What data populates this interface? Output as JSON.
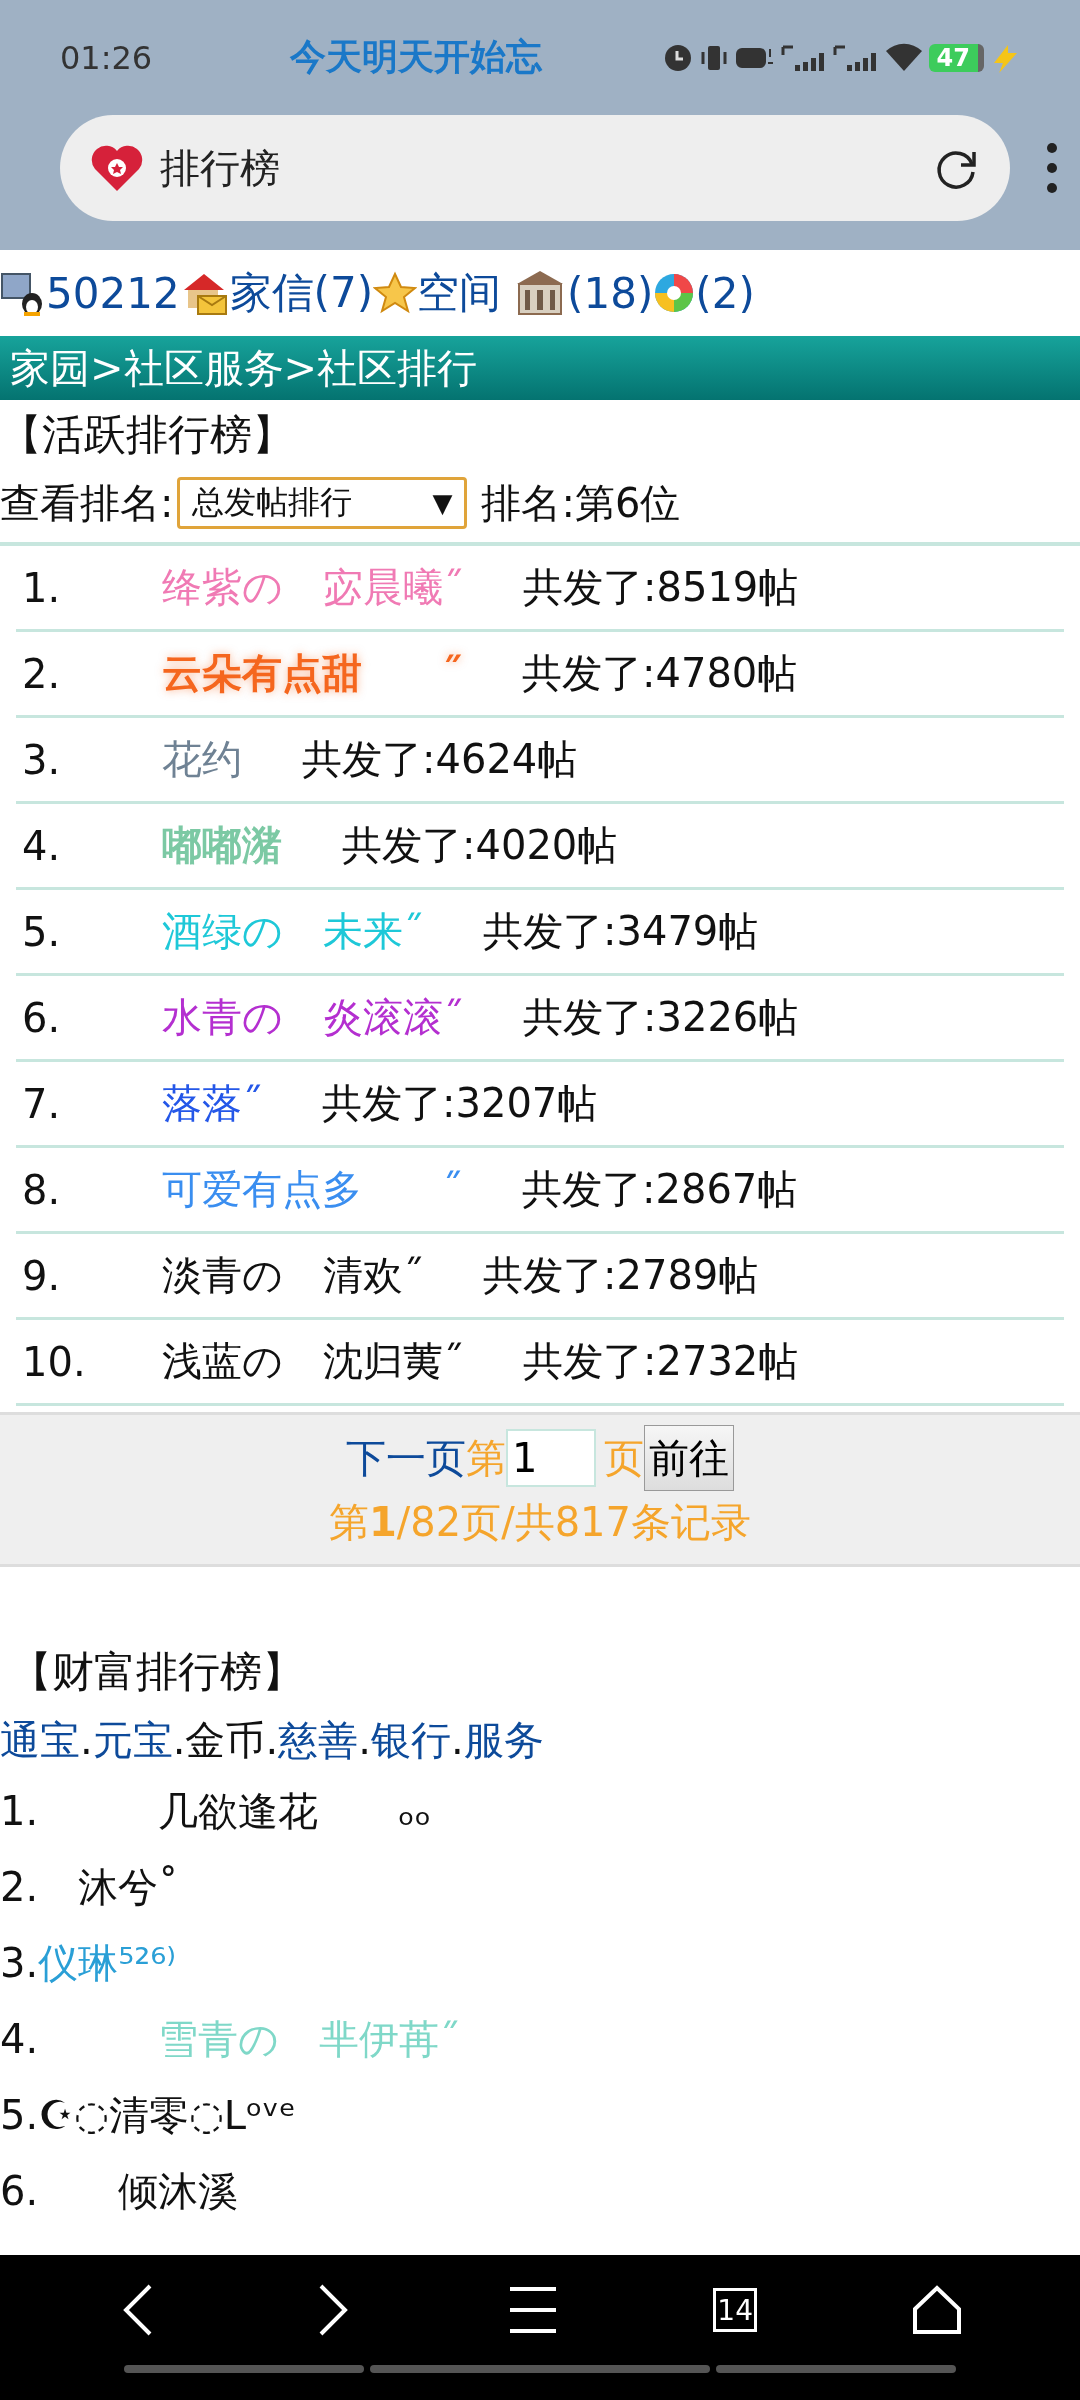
{
  "status_bar": {
    "time": "01:26",
    "ticker": "今天明天开始忘",
    "battery": "47"
  },
  "address_bar": {
    "title": "排行榜"
  },
  "toolbar": [
    {
      "kind": "user",
      "label": "50212"
    },
    {
      "kind": "mail",
      "label": "家信(7)"
    },
    {
      "kind": "star",
      "label": "空间"
    },
    {
      "kind": "building",
      "label": "(18)"
    },
    {
      "kind": "aperture",
      "label": "(2)"
    }
  ],
  "breadcrumb": "家园>社区服务>社区排行",
  "active_ranking": {
    "heading": "【活跃排行榜】",
    "filter_label": "查看排名:",
    "filter_value": "总发帖排行",
    "filter_arrow": "▼",
    "my_rank": "排名:第6位",
    "rows": [
      {
        "rank": "1.",
        "name": "绛紫の　宓晨曦˝",
        "color": "#f07ab4",
        "bold": false,
        "posts": "共发了:8519帖"
      },
      {
        "rank": "2.",
        "name": "云朵有点甜　　˝",
        "color": "#f5661e",
        "bold": true,
        "posts": "共发了:4780帖"
      },
      {
        "rank": "3.",
        "name": "花约",
        "color": "#6f8294",
        "bold": false,
        "posts": "共发了:4624帖"
      },
      {
        "rank": "4.",
        "name": "嘟嘟潴",
        "color": "#7cc9a4",
        "bold": true,
        "posts": "共发了:4020帖"
      },
      {
        "rank": "5.",
        "name": "酒绿の　未来˝",
        "color": "#1ec8d8",
        "bold": false,
        "posts": "共发了:3479帖"
      },
      {
        "rank": "6.",
        "name": "水青の　炎滚滚˝",
        "color": "#b42fd0",
        "bold": false,
        "posts": "共发了:3226帖"
      },
      {
        "rank": "7.",
        "name": "落落˝",
        "color": "#2457e8",
        "bold": false,
        "posts": "共发了:3207帖"
      },
      {
        "rank": "8.",
        "name": "可爱有点多　　˝",
        "color": "#3a8ef0",
        "bold": false,
        "posts": "共发了:2867帖"
      },
      {
        "rank": "9.",
        "name": "淡青の　清欢˝",
        "color": "#111111",
        "bold": false,
        "posts": "共发了:2789帖"
      },
      {
        "rank": "10.",
        "name": "浅蓝の　沈归荑˝",
        "color": "#111111",
        "bold": false,
        "posts": "共发了:2732帖"
      }
    ],
    "pager": {
      "next": "下一页",
      "before_input": "第",
      "page_input": "1",
      "after_input": "页",
      "go_button": "前往",
      "summary": "第**1**/82页/共817条记录"
    }
  },
  "wealth_ranking": {
    "heading": "【财富排行榜】",
    "tabs": [
      {
        "label": "通宝",
        "selected": false
      },
      {
        "sep": ".",
        "label": "元宝",
        "selected": false
      },
      {
        "sep": ".",
        "label": "金币",
        "selected": true
      },
      {
        "sep": ".",
        "label": "慈善",
        "selected": false
      },
      {
        "sep": ".",
        "label": "银行",
        "selected": false
      },
      {
        "sep": ".",
        "label": "服务",
        "selected": false
      }
    ],
    "rows": [
      {
        "rank": "1.",
        "name": "　　　几欲逢花　　ₒₒ",
        "color": "#111111"
      },
      {
        "rank": "2.",
        "name": "　沐兮˚",
        "color": "#111111"
      },
      {
        "rank": "3.",
        "name": "仪琳⁵²⁶⁾",
        "color": "#2a9fd6"
      },
      {
        "rank": "4.",
        "name": "　　　雪青の　芈伊苒˝",
        "color": "#7fd8c8"
      },
      {
        "rank": "5.",
        "name": "☪◌清零◌ᒪᵒᵛᵉ",
        "color": "#111111"
      },
      {
        "rank": "6.",
        "name": "　　倾沐溪",
        "color": "#111111"
      }
    ]
  },
  "nav_bar": {
    "tabs_count": "14"
  }
}
